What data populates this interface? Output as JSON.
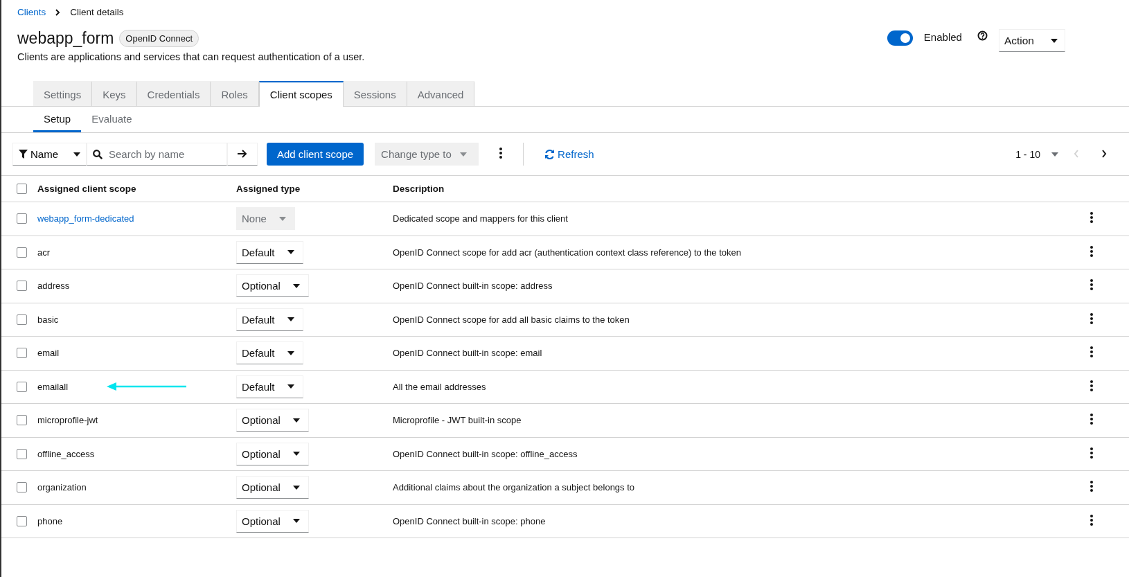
{
  "breadcrumb": [
    {
      "label": "Clients",
      "link": true
    },
    {
      "label": "Client details",
      "link": false
    }
  ],
  "header": {
    "title": "webapp_form",
    "badge": "OpenID Connect",
    "description": "Clients are applications and services that can request authentication of a user.",
    "enabled": {
      "label": "Enabled",
      "on": true
    },
    "action": "Action"
  },
  "tabs": [
    {
      "label": "Settings",
      "selected": false
    },
    {
      "label": "Keys",
      "selected": false
    },
    {
      "label": "Credentials",
      "selected": false
    },
    {
      "label": "Roles",
      "selected": false
    },
    {
      "label": "Client scopes",
      "selected": true
    },
    {
      "label": "Sessions",
      "selected": false
    },
    {
      "label": "Advanced",
      "selected": false
    }
  ],
  "subtabs": [
    {
      "label": "Setup",
      "selected": true
    },
    {
      "label": "Evaluate",
      "selected": false
    }
  ],
  "toolbar": {
    "filter": "Name",
    "search": {
      "placeholder": "Search by name"
    },
    "add": "Add client scope",
    "change_type": {
      "label": "Change type to",
      "disabled": true
    },
    "refresh": "Refresh",
    "pagination": "1 - 10"
  },
  "table": {
    "select_all_checked": false,
    "columns": [
      "Assigned client scope",
      "Assigned type",
      "Description"
    ],
    "rows": [
      {
        "name": "webapp_form-dedicated",
        "link": true,
        "type": "None",
        "type_disabled": true,
        "description": "Dedicated scope and mappers for this client",
        "checked": false,
        "arrow": false
      },
      {
        "name": "acr",
        "link": false,
        "type": "Default",
        "type_disabled": false,
        "description": "OpenID Connect scope for add acr (authentication context class reference) to the token",
        "checked": false,
        "arrow": false
      },
      {
        "name": "address",
        "link": false,
        "type": "Optional",
        "type_disabled": false,
        "description": "OpenID Connect built-in scope: address",
        "checked": false,
        "arrow": false
      },
      {
        "name": "basic",
        "link": false,
        "type": "Default",
        "type_disabled": false,
        "description": "OpenID Connect scope for add all basic claims to the token",
        "checked": false,
        "arrow": false
      },
      {
        "name": "email",
        "link": false,
        "type": "Default",
        "type_disabled": false,
        "description": "OpenID Connect built-in scope: email",
        "checked": false,
        "arrow": false
      },
      {
        "name": "emailall",
        "link": false,
        "type": "Default",
        "type_disabled": false,
        "description": "All the email addresses",
        "checked": false,
        "arrow": true
      },
      {
        "name": "microprofile-jwt",
        "link": false,
        "type": "Optional",
        "type_disabled": false,
        "description": "Microprofile - JWT built-in scope",
        "checked": false,
        "arrow": false
      },
      {
        "name": "offline_access",
        "link": false,
        "type": "Optional",
        "type_disabled": false,
        "description": "OpenID Connect built-in scope: offline_access",
        "checked": false,
        "arrow": false
      },
      {
        "name": "organization",
        "link": false,
        "type": "Optional",
        "type_disabled": false,
        "description": "Additional claims about the organization a subject belongs to",
        "checked": false,
        "arrow": false
      },
      {
        "name": "phone",
        "link": false,
        "type": "Optional",
        "type_disabled": false,
        "description": "OpenID Connect built-in scope: phone",
        "checked": false,
        "arrow": false
      }
    ]
  }
}
